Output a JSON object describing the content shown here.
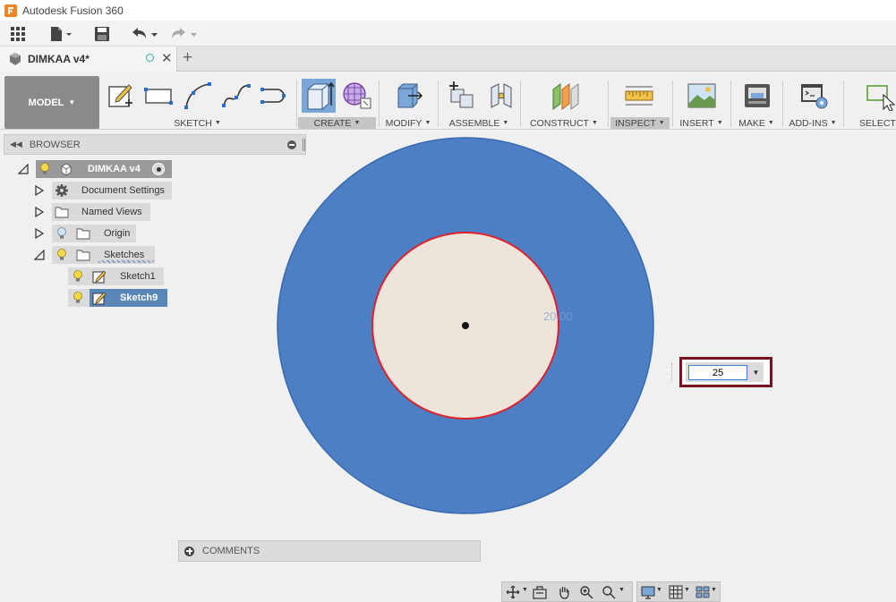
{
  "window": {
    "title": "Autodesk Fusion 360"
  },
  "document_tab": {
    "title": "DIMKAA v4*"
  },
  "workspace": {
    "label": "MODEL"
  },
  "ribbon": {
    "groups": [
      {
        "label": "SKETCH"
      },
      {
        "label": "CREATE"
      },
      {
        "label": "MODIFY"
      },
      {
        "label": "ASSEMBLE"
      },
      {
        "label": "CONSTRUCT"
      },
      {
        "label": "INSPECT"
      },
      {
        "label": "INSERT"
      },
      {
        "label": "MAKE"
      },
      {
        "label": "ADD-INS"
      },
      {
        "label": "SELECT"
      }
    ]
  },
  "browser": {
    "header": "BROWSER",
    "root": "DIMKAA v4",
    "items": [
      {
        "label": "Document Settings",
        "icon": "gear-icon"
      },
      {
        "label": "Named Views",
        "icon": "folder-icon"
      },
      {
        "label": "Origin",
        "icon": "folder-icon"
      },
      {
        "label": "Sketches",
        "icon": "folder-icon"
      }
    ],
    "sketches": [
      {
        "label": "Sketch1"
      },
      {
        "label": "Sketch9"
      }
    ]
  },
  "canvas": {
    "ghost_dimension": "20.00",
    "colors": {
      "outer_fill": "#4d7fc4",
      "inner_fill": "#ede4db",
      "inner_stroke": "#e0202a"
    }
  },
  "dimension_input": {
    "value": "25"
  },
  "comments": {
    "label": "COMMENTS"
  }
}
